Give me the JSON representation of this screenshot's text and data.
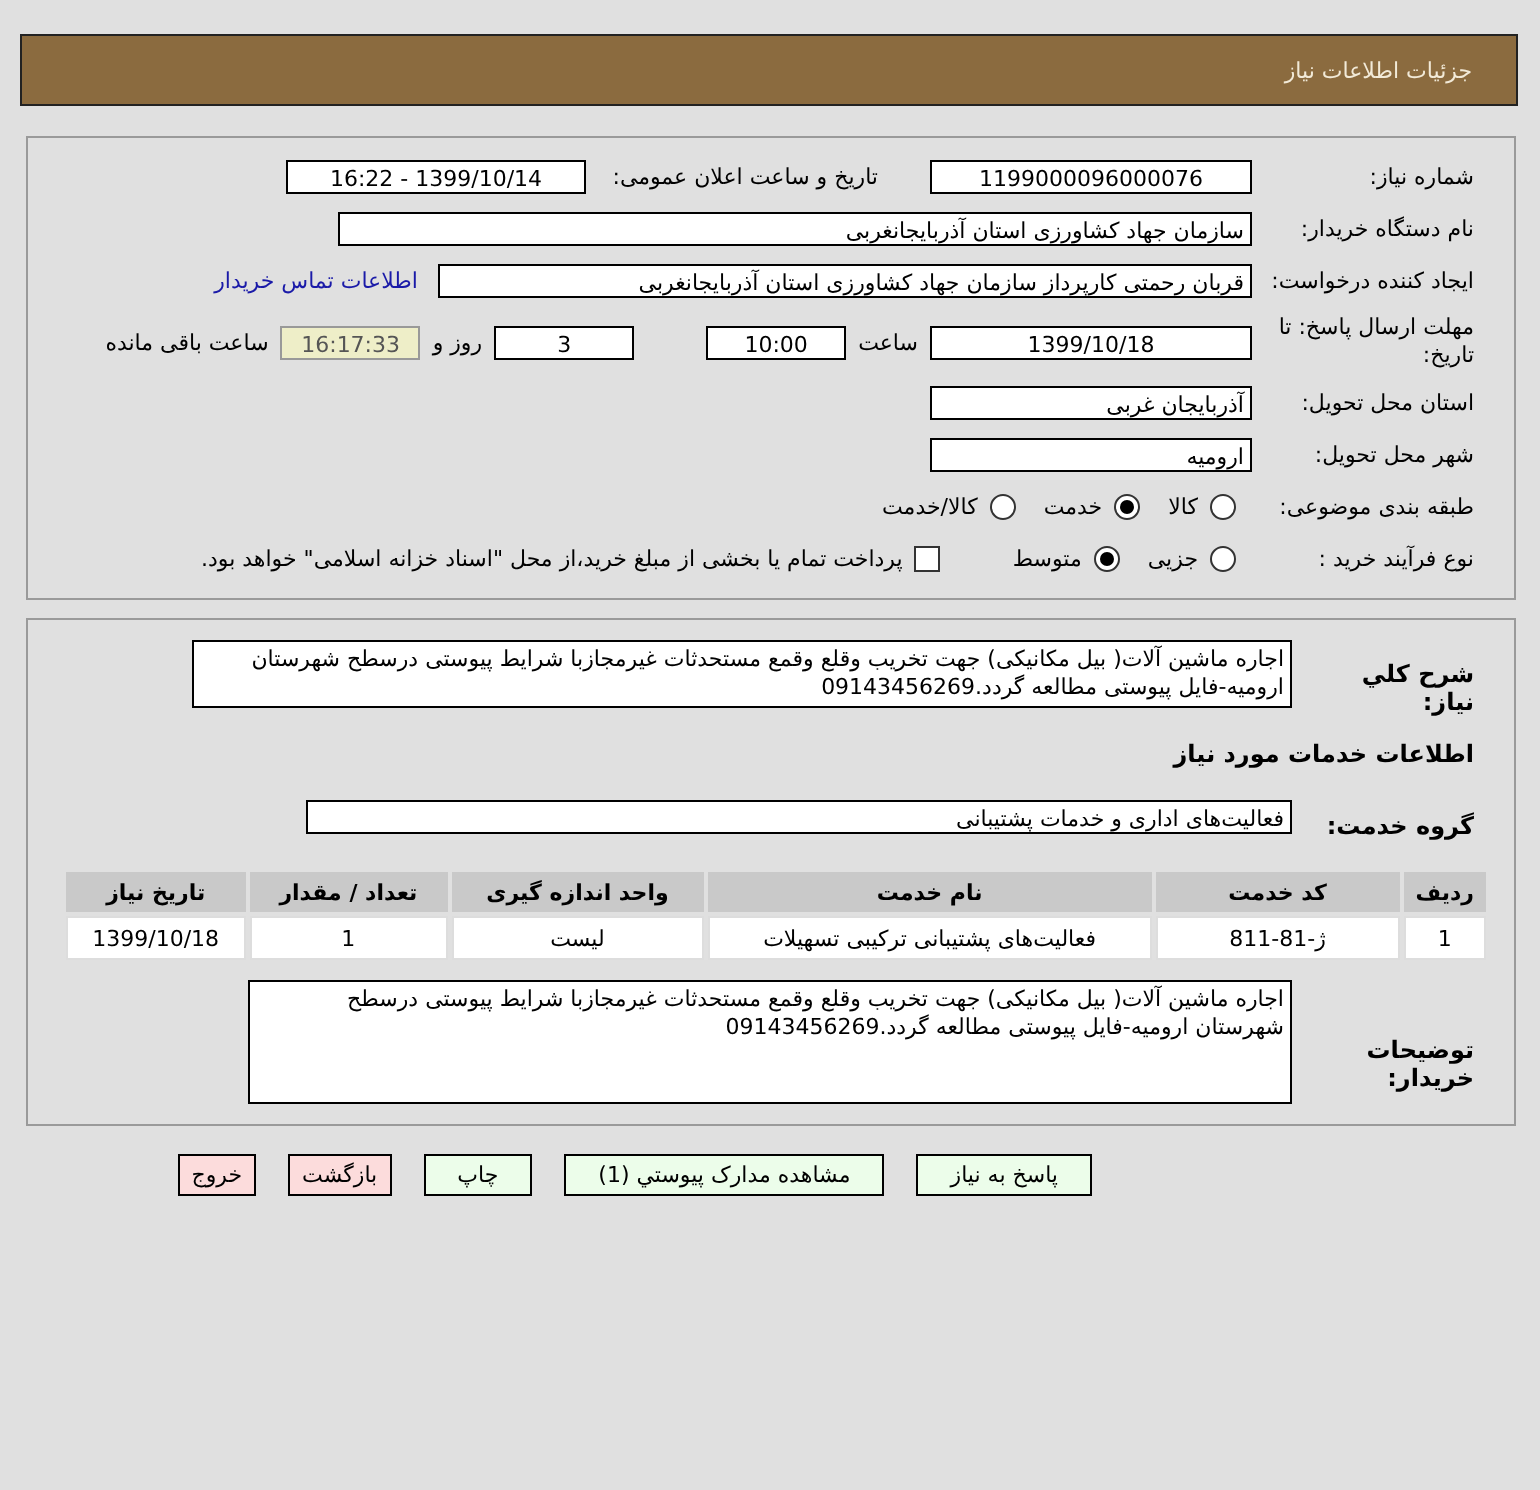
{
  "header": {
    "title": "جزئیات اطلاعات نیاز"
  },
  "need_number": {
    "label": "شماره نیاز:",
    "value": "1199000096000076"
  },
  "announce": {
    "label": "تاریخ و ساعت اعلان عمومی:",
    "value": "1399/10/14 - 16:22"
  },
  "buyer_org": {
    "label": "نام دستگاه خریدار:",
    "value": "سازمان جهاد کشاورزی استان آذربایجانغربی"
  },
  "requester": {
    "label": "ایجاد کننده درخواست:",
    "value": "قربان  رحمتی  کارپرداز سازمان جهاد کشاورزی استان آذربایجانغربی",
    "link": "اطلاعات تماس خریدار"
  },
  "deadline": {
    "label": "مهلت ارسال پاسخ: تا تاریخ:",
    "date": "1399/10/18",
    "time_label": "ساعت",
    "time": "10:00",
    "days": "3",
    "days_label": "روز و",
    "remaining": "16:17:33",
    "remaining_label": "ساعت باقی مانده"
  },
  "province": {
    "label": "استان محل تحویل:",
    "value": "آذربایجان غربی"
  },
  "city": {
    "label": "شهر محل تحویل:",
    "value": "ارومیه"
  },
  "category": {
    "label": "طبقه بندی موضوعی:",
    "options": [
      {
        "label": "کالا",
        "selected": false
      },
      {
        "label": "خدمت",
        "selected": true
      },
      {
        "label": "کالا/خدمت",
        "selected": false
      }
    ]
  },
  "process": {
    "label": "نوع فرآیند خرید :",
    "options": [
      {
        "label": "جزیی",
        "selected": false
      },
      {
        "label": "متوسط",
        "selected": true
      }
    ],
    "payment": {
      "checked": false,
      "label": "پرداخت تمام یا بخشی از مبلغ خرید،از محل \"اسناد خزانه اسلامی\" خواهد بود."
    }
  },
  "description": {
    "label": "شرح کلي نياز:",
    "value": "اجاره ماشین آلات( بیل مکانیکی) جهت تخریب وقلع وقمع مستحدثات غیرمجازبا شرایط پیوستی درسطح شهرستان ارومیه-فایل پیوستی مطالعه گردد.09143456269"
  },
  "services_title": "اطلاعات خدمات مورد نياز",
  "service_group": {
    "label": "گروه خدمت:",
    "value": "فعالیت‌های اداری و خدمات پشتیبانی"
  },
  "table": {
    "columns": [
      "ردیف",
      "کد خدمت",
      "نام خدمت",
      "واحد اندازه گیری",
      "تعداد / مقدار",
      "تاریخ نیاز"
    ],
    "rows": [
      [
        "1",
        "ژ-81-811",
        "فعالیت‌های پشتیبانی ترکیبی تسهیلات",
        "لیست",
        "1",
        "1399/10/18"
      ]
    ]
  },
  "buyer_notes": {
    "label": "توضیحات خریدار:",
    "value": "اجاره ماشین آلات( بیل مکانیکی) جهت تخریب وقلع وقمع مستحدثات غیرمجازبا شرایط پیوستی درسطح شهرستان ارومیه-فایل پیوستی مطالعه گردد.09143456269"
  },
  "buttons": [
    {
      "label": "پاسخ به نیاز",
      "kind": "action"
    },
    {
      "label": "مشاهده مدارک پیوستي (1)",
      "kind": "action"
    },
    {
      "label": "چاپ",
      "kind": "action"
    },
    {
      "label": "بازگشت",
      "kind": "exit"
    },
    {
      "label": "خروج",
      "kind": "exit"
    }
  ]
}
